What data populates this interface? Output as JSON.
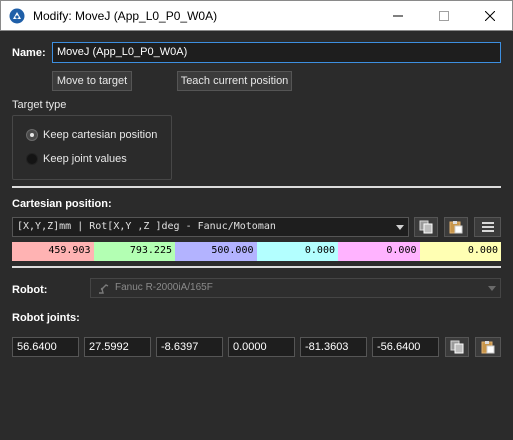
{
  "window": {
    "title": "Modify: MoveJ (App_L0_P0_W0A)",
    "icons": [
      "app-logo-icon",
      "minimize-icon",
      "maximize-icon",
      "close-icon"
    ]
  },
  "name": {
    "label": "Name:",
    "value": "MoveJ (App_L0_P0_W0A)"
  },
  "buttons": {
    "move_to_target": "Move to target",
    "teach_current_position": "Teach current position"
  },
  "target_type": {
    "label": "Target type",
    "options": [
      {
        "label": "Keep cartesian position",
        "selected": true
      },
      {
        "label": "Keep joint values",
        "selected": false
      }
    ]
  },
  "cartesian": {
    "label": "Cartesian position:",
    "format": "[X,Y,Z]mm | Rot[X,Y ,Z  ]deg - Fanuc/Motoman",
    "toolbar_icons": [
      "copy-icon",
      "paste-icon",
      "menu-icon"
    ],
    "values": [
      "459.903",
      "793.225",
      "500.000",
      "0.000",
      "0.000",
      "0.000"
    ],
    "cell_colors": [
      "#ffb3b3",
      "#b3ffb3",
      "#b3b3ff",
      "#b3ffff",
      "#ffb3ff",
      "#ffffb3"
    ]
  },
  "robot": {
    "label": "Robot:",
    "value": "Fanuc R-2000iA/165F",
    "icon": "robot-arm-icon",
    "enabled": false
  },
  "robot_joints": {
    "label": "Robot joints:",
    "values": [
      "56.6400",
      "27.5992",
      "-8.6397",
      "0.0000",
      "-81.3603",
      "-56.6400"
    ],
    "toolbar_icons": [
      "copy-icon",
      "paste-icon"
    ]
  },
  "colors": {
    "background": "#2b2b2b",
    "accent": "#3d8fe0"
  }
}
